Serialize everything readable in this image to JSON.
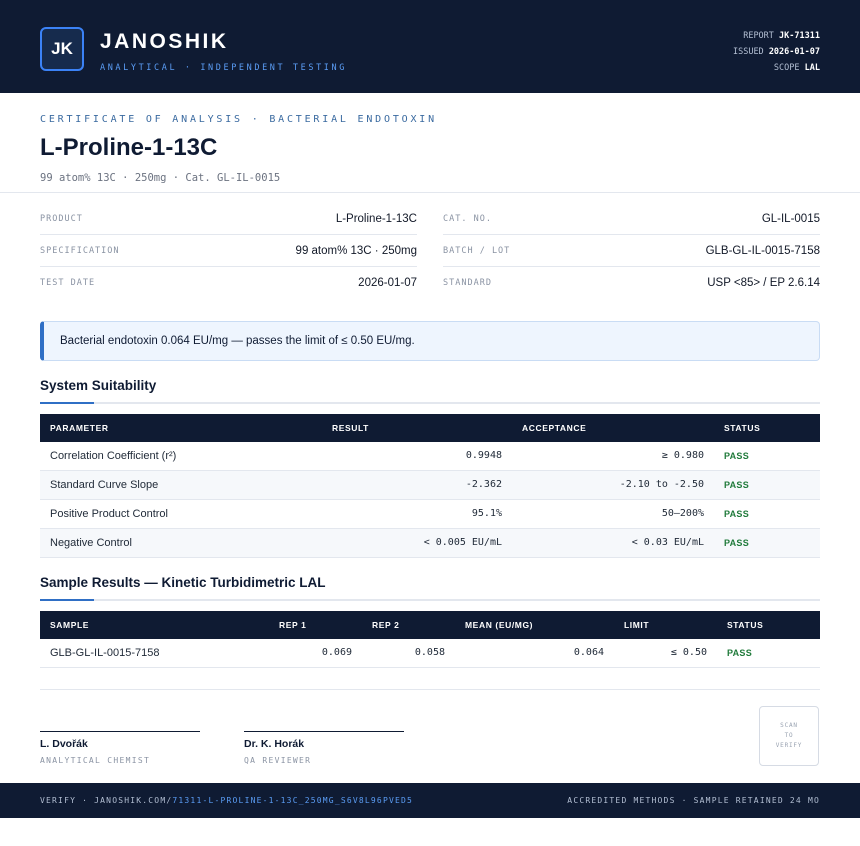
{
  "header": {
    "logo_text": "JK",
    "brand": "JANOSHIK",
    "tagline": "ANALYTICAL · INDEPENDENT TESTING",
    "meta": [
      {
        "label": "REPORT",
        "value": "JK-71311"
      },
      {
        "label": "ISSUED",
        "value": "2026-01-07"
      },
      {
        "label": "SCOPE",
        "value": "LAL"
      }
    ]
  },
  "document": {
    "kicker": "CERTIFICATE OF ANALYSIS · BACTERIAL ENDOTOXIN",
    "title": "L-Proline-1-13C",
    "subtitle": "99 atom% 13C · 250mg  ·  Cat. GL-IL-0015"
  },
  "info": {
    "left": [
      {
        "label": "PRODUCT",
        "value": "L-Proline-1-13C"
      },
      {
        "label": "SPECIFICATION",
        "value": "99 atom% 13C · 250mg"
      },
      {
        "label": "TEST DATE",
        "value": "2026-01-07"
      }
    ],
    "right": [
      {
        "label": "CAT. NO.",
        "value": "GL-IL-0015"
      },
      {
        "label": "BATCH / LOT",
        "value": "GLB-GL-IL-0015-7158"
      },
      {
        "label": "STANDARD",
        "value": "USP <85> / EP 2.6.14"
      }
    ]
  },
  "banner": "Bacterial endotoxin 0.064 EU/mg — passes the limit of ≤ 0.50 EU/mg.",
  "suitability": {
    "title": "System Suitability",
    "headers": [
      "PARAMETER",
      "RESULT",
      "ACCEPTANCE",
      "STATUS"
    ],
    "rows": [
      {
        "parameter": "Correlation Coefficient (r²)",
        "result": "0.9948",
        "acceptance": "≥ 0.980",
        "status": "PASS"
      },
      {
        "parameter": "Standard Curve Slope",
        "result": "-2.362",
        "acceptance": "-2.10 to -2.50",
        "status": "PASS"
      },
      {
        "parameter": "Positive Product Control",
        "result": "95.1%",
        "acceptance": "50–200%",
        "status": "PASS"
      },
      {
        "parameter": "Negative Control",
        "result": "< 0.005 EU/mL",
        "acceptance": "< 0.03 EU/mL",
        "status": "PASS"
      }
    ]
  },
  "samples": {
    "title": "Sample Results — Kinetic Turbidimetric LAL",
    "headers": [
      "SAMPLE",
      "REP 1",
      "REP 2",
      "MEAN (EU/MG)",
      "LIMIT",
      "STATUS"
    ],
    "rows": [
      {
        "sample": "GLB-GL-IL-0015-7158",
        "rep1": "0.069",
        "rep2": "0.058",
        "mean": "0.064",
        "limit": "≤ 0.50",
        "status": "PASS"
      }
    ]
  },
  "signatures": [
    {
      "name": "L. Dvořák",
      "role": "ANALYTICAL CHEMIST"
    },
    {
      "name": "Dr. K. Horák",
      "role": "QA REVIEWER"
    }
  ],
  "qr_text": [
    "SCAN",
    "TO",
    "VERIFY"
  ],
  "footer": {
    "verify_prefix": "VERIFY · JANOSHIK.COM/",
    "verify_link": "71311-L-PROLINE-1-13C_250MG_S6V8L96PVED5",
    "right": "ACCREDITED METHODS · SAMPLE RETAINED 24 MO"
  },
  "colors": {
    "navy": "#0f1b33",
    "accent": "#2f6fc5",
    "pass": "#1f7a3a"
  }
}
